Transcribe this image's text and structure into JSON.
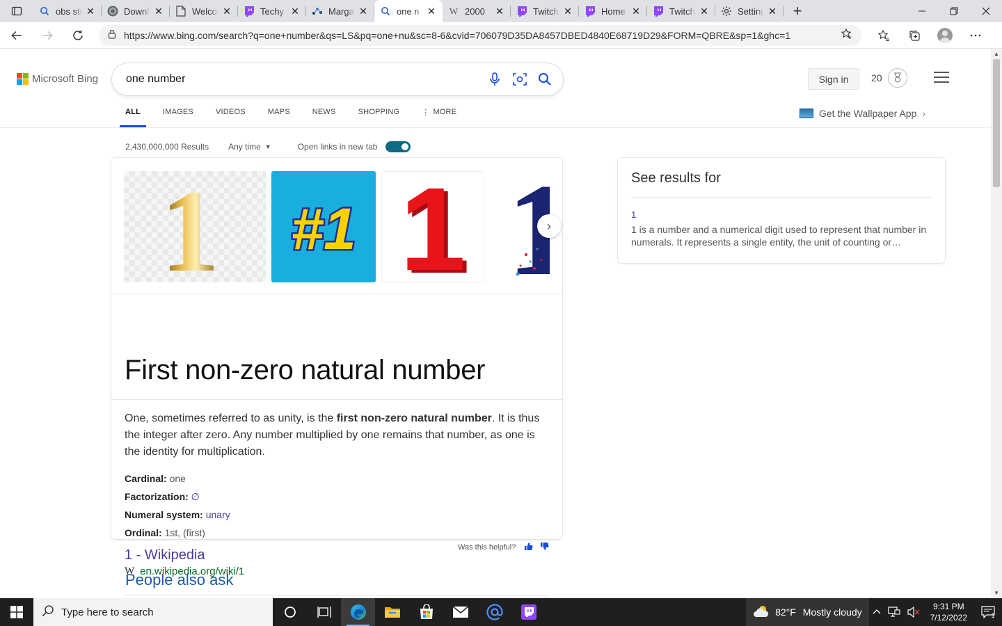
{
  "browser": {
    "tabs": [
      {
        "label": "obs studio",
        "icon": "search-icon",
        "active": false
      },
      {
        "label": "Download",
        "icon": "obs-icon",
        "active": false
      },
      {
        "label": "Welcome",
        "icon": "page-icon",
        "active": false
      },
      {
        "label": "Techy",
        "icon": "twitch-icon",
        "active": false
      },
      {
        "label": "Margaret",
        "icon": "dots-icon",
        "active": false
      },
      {
        "label": "one n",
        "icon": "search-icon",
        "active": true
      },
      {
        "label": "2000",
        "icon": "wikipedia-icon",
        "active": false
      },
      {
        "label": "Twitch",
        "icon": "twitch-icon",
        "active": false
      },
      {
        "label": "Home",
        "icon": "twitch-icon",
        "active": false
      },
      {
        "label": "Twitch",
        "icon": "twitch-icon",
        "active": false
      },
      {
        "label": "Settings",
        "icon": "gear-icon",
        "active": false
      }
    ],
    "url": "https://www.bing.com/search?q=one+number&qs=LS&pq=one+nu&sc=8-6&cvid=706079D35DA8457DBED4840E68719D29&FORM=QBRE&sp=1&ghc=1"
  },
  "bing": {
    "logo_text": "Microsoft Bing",
    "query": "one number",
    "sign_in": "Sign in",
    "rewards_count": "20",
    "scopes": [
      "ALL",
      "IMAGES",
      "VIDEOS",
      "MAPS",
      "NEWS",
      "SHOPPING",
      "MORE"
    ],
    "wallpaper_link": "Get the Wallpaper App",
    "results_count": "2,430,000,000 Results",
    "time_filter": "Any time",
    "open_links_label": "Open links in new tab",
    "open_links_enabled": true
  },
  "answer": {
    "title": "First non-zero natural number",
    "desc_pre": "One, sometimes referred to as unity, is the ",
    "desc_bold": "first non-zero natural number",
    "desc_post": ". It is thus the integer after zero. Any number multiplied by one remains that number, as one is the identity for multiplication.",
    "facts": [
      {
        "label": "Cardinal:",
        "value": "one",
        "link": false
      },
      {
        "label": "Factorization:",
        "value": "∅",
        "link": true
      },
      {
        "label": "Numeral system:",
        "value": "unary",
        "link": true
      },
      {
        "label": "Ordinal:",
        "value": "1st, (first)",
        "link": false
      }
    ],
    "wiki_title": "1 - Wikipedia",
    "wiki_url": "en.wikipedia.org/wiki/1",
    "wiki_glyph": "W",
    "images": [
      "1",
      "#1",
      "1",
      "1"
    ]
  },
  "feedback": {
    "label": "Was this helpful?"
  },
  "people_also_ask": "People also ask",
  "see_results": {
    "heading": "See results for",
    "link": "1",
    "desc": "1 is a number and a numerical digit used to represent that number in numerals. It represents a single entity, the unit of counting or measurement."
  },
  "taskbar": {
    "search_placeholder": "Type here to search",
    "weather_temp": "82°F",
    "weather_desc": "Mostly cloudy",
    "time": "9:31 PM",
    "date": "7/12/2022",
    "notification_count": "1"
  },
  "colors": {
    "accent": "#174ae4",
    "link": "#4a3c9c",
    "url_green": "#006d21",
    "toggle": "#0f6b82"
  }
}
